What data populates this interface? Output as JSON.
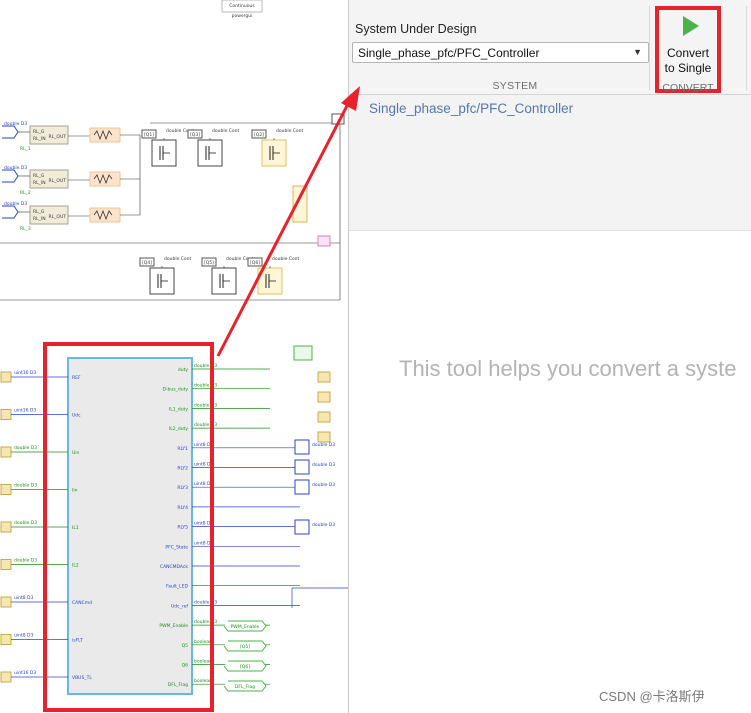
{
  "model_canvas": {
    "top_block": {
      "label": "Continuous",
      "sublabel": "powergui"
    },
    "rl_blocks": [
      {
        "in1": "RL_G",
        "in2": "RL_IN",
        "out": "RL_OUT",
        "sig": "double D3",
        "name": "RL_1"
      },
      {
        "in1": "RL_G",
        "in2": "RL_IN",
        "out": "RL_OUT",
        "sig": "double D3",
        "name": "RL_2"
      },
      {
        "in1": "RL_G",
        "in2": "RL_IN",
        "out": "RL_OUT",
        "sig": "double D3",
        "name": "RL_3"
      }
    ],
    "gate_tags": [
      "[Q1]",
      "[Q3]",
      "[Q2]",
      "[Q4]",
      "[Q5]",
      "[Q6]"
    ],
    "gate_sig": "double Cont",
    "controller": {
      "inputs": [
        "REF",
        "Udc",
        "Uin",
        "Iin",
        "IL1",
        "IL2",
        "CANCmd",
        "isFLT",
        "VBUS_TL"
      ],
      "input_sigs": [
        "uint16 D3",
        "uint16 D3",
        "double D3",
        "double D3",
        "double D3",
        "double D3",
        "uint8 D3",
        "uint8 D3",
        "uint16 D3"
      ],
      "outputs": [
        "duty",
        "D-bus_duty",
        "IL1_duty",
        "IL2_duty",
        "RLY1",
        "RLY2",
        "RLY3",
        "RLY4",
        "RLY5",
        "PFC_State",
        "CANCMDAck",
        "Fault_LED",
        "Udc_ref",
        "PWM_Enable",
        "Q5",
        "Q6",
        "DFL_Flag"
      ],
      "output_sigs": [
        "double D3",
        "double D3",
        "double D3",
        "double D3",
        "uint8 D3",
        "uint8 D3",
        "uint8 D3",
        "",
        "uint8 D3",
        "uint8 D3",
        "",
        "",
        "double D3",
        "double D3",
        "boolean",
        "boolean",
        "boolean"
      ]
    },
    "goto_tags": [
      "PWM_Enable",
      "[Q5]",
      "[Q6]",
      "DFL_Flag"
    ],
    "display_sig": "double D3"
  },
  "toolstrip": {
    "system_label": "System Under Design",
    "system_value": "Single_phase_pfc/PFC_Controller",
    "system_section": "SYSTEM",
    "convert_label_1": "Convert",
    "convert_label_2": "to Single",
    "convert_section": "CONVERT"
  },
  "path": "Single_phase_pfc/PFC_Controller",
  "hint": "This tool helps you convert a syste",
  "watermark": "CSDN @卡洛斯伊",
  "colors": {
    "highlight_red": "#e8222a",
    "signal_blue": "#2a44c8",
    "signal_green": "#1c8f1c",
    "run_green": "#4bb348"
  }
}
